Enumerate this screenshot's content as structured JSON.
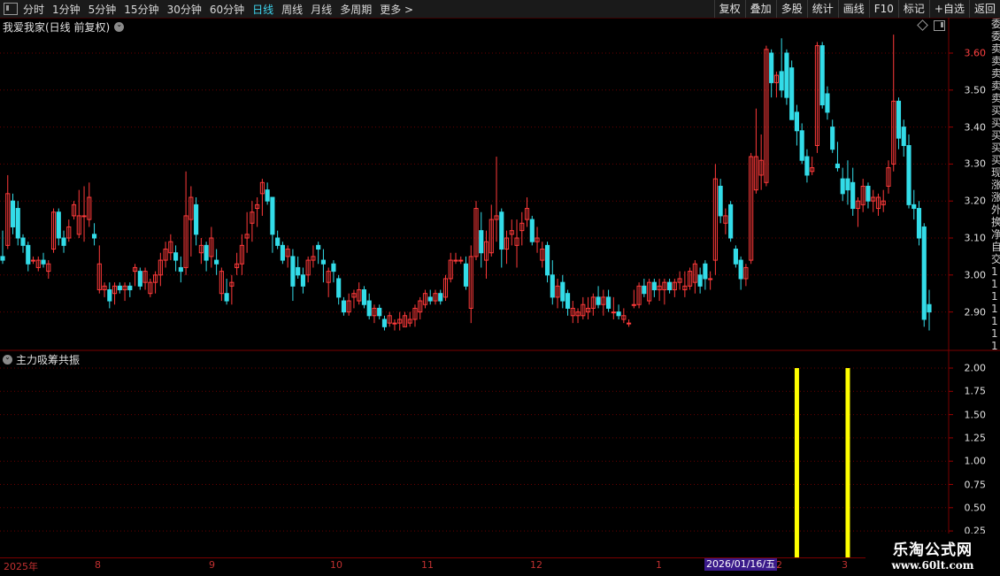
{
  "toolbar": {
    "periods": [
      "分时",
      "1分钟",
      "5分钟",
      "15分钟",
      "30分钟",
      "60分钟",
      "日线",
      "周线",
      "月线",
      "多周期",
      "更多 >"
    ],
    "active_period": "日线",
    "actions": [
      "复权",
      "叠加",
      "多股",
      "统计",
      "画线",
      "F10",
      "标记",
      "+自选",
      "返回"
    ]
  },
  "main_panel": {
    "title": "我爱我家(日线 前复权)",
    "price_ticks": [
      "3.60",
      "3.50",
      "3.40",
      "3.30",
      "3.20",
      "3.10",
      "3.00",
      "2.90"
    ]
  },
  "sub_panel": {
    "title": "主力吸筹共振",
    "ticks": [
      "2.00",
      "1.75",
      "1.50",
      "1.25",
      "1.00",
      "0.75",
      "0.50",
      "0.25"
    ]
  },
  "date_axis": {
    "labels": [
      "2025年",
      "8",
      "9",
      "10",
      "11",
      "12",
      "1",
      "2",
      "3"
    ],
    "cursor_date": "2026/01/16/五"
  },
  "right_strip": [
    "委",
    "委",
    "卖",
    "卖",
    "卖",
    "卖",
    "卖",
    "买",
    "买",
    "买",
    "买",
    "买",
    "现",
    "涨",
    "涨",
    "外",
    "换",
    "净",
    "自",
    "交",
    "1",
    "1",
    "1",
    "1",
    "1",
    "1",
    "1"
  ],
  "watermark": {
    "name": "乐淘公式网",
    "url": "www.60lt.com"
  },
  "colors": {
    "up": "#ff3a3a",
    "down": "#33dce8",
    "signal": "#ffff00",
    "grid": "#6a0000"
  },
  "chart_data": {
    "type": "candlestick",
    "price_range": [
      2.83,
      3.66
    ],
    "indicator_range": [
      0,
      2.2
    ],
    "signals": [
      {
        "index": 156,
        "value": 2.0
      },
      {
        "index": 166,
        "value": 2.0
      }
    ],
    "candles": [
      [
        3.05,
        3.12,
        3.03,
        3.04
      ],
      [
        3.08,
        3.27,
        3.07,
        3.22
      ],
      [
        3.2,
        3.22,
        3.11,
        3.13
      ],
      [
        3.18,
        3.2,
        3.08,
        3.1
      ],
      [
        3.1,
        3.11,
        3.06,
        3.08
      ],
      [
        3.08,
        3.09,
        3.01,
        3.03
      ],
      [
        3.04,
        3.05,
        3.03,
        3.04
      ],
      [
        3.02,
        3.05,
        3.01,
        3.04
      ],
      [
        3.04,
        3.06,
        3.02,
        3.03
      ],
      [
        3.01,
        3.04,
        2.99,
        3.03
      ],
      [
        3.07,
        3.18,
        3.06,
        3.17
      ],
      [
        3.17,
        3.18,
        3.08,
        3.1
      ],
      [
        3.1,
        3.12,
        3.06,
        3.08
      ],
      [
        3.1,
        3.15,
        3.09,
        3.13
      ],
      [
        3.16,
        3.2,
        3.15,
        3.19
      ],
      [
        3.11,
        3.23,
        3.1,
        3.16
      ],
      [
        3.16,
        3.24,
        3.09,
        3.16
      ],
      [
        3.15,
        3.25,
        3.13,
        3.21
      ],
      [
        3.11,
        3.14,
        3.08,
        3.1
      ],
      [
        2.96,
        3.08,
        2.95,
        3.03
      ],
      [
        2.96,
        2.98,
        2.94,
        2.97
      ],
      [
        2.96,
        2.98,
        2.91,
        2.93
      ],
      [
        2.95,
        2.98,
        2.92,
        2.97
      ],
      [
        2.97,
        2.98,
        2.95,
        2.96
      ],
      [
        2.96,
        2.98,
        2.93,
        2.97
      ],
      [
        2.97,
        2.98,
        2.94,
        2.96
      ],
      [
        3.01,
        3.03,
        2.97,
        3.02
      ],
      [
        3.01,
        3.02,
        2.96,
        2.97
      ],
      [
        2.98,
        3.02,
        2.96,
        3.01
      ],
      [
        2.95,
        2.99,
        2.94,
        2.98
      ],
      [
        2.98,
        3.01,
        2.95,
        3.0
      ],
      [
        3.0,
        3.06,
        2.97,
        3.04
      ],
      [
        3.04,
        3.09,
        3.02,
        3.07
      ],
      [
        3.06,
        3.11,
        3.04,
        3.09
      ],
      [
        3.06,
        3.08,
        3.01,
        3.04
      ],
      [
        3.02,
        3.05,
        2.98,
        3.01
      ],
      [
        3.02,
        3.28,
        3.0,
        3.16
      ],
      [
        3.15,
        3.24,
        3.05,
        3.21
      ],
      [
        3.19,
        3.21,
        3.08,
        3.11
      ],
      [
        3.06,
        3.1,
        3.03,
        3.08
      ],
      [
        3.08,
        3.09,
        3.01,
        3.04
      ],
      [
        3.05,
        3.13,
        3.02,
        3.1
      ],
      [
        3.04,
        3.07,
        3.0,
        3.03
      ],
      [
        2.95,
        3.02,
        2.93,
        3.01
      ],
      [
        2.95,
        2.99,
        2.92,
        2.93
      ],
      [
        2.97,
        3.0,
        2.92,
        2.98
      ],
      [
        3.02,
        3.06,
        3.0,
        3.03
      ],
      [
        3.03,
        3.11,
        3.0,
        3.08
      ],
      [
        3.1,
        3.17,
        3.06,
        3.11
      ],
      [
        3.14,
        3.2,
        3.09,
        3.17
      ],
      [
        3.18,
        3.21,
        3.13,
        3.19
      ],
      [
        3.22,
        3.26,
        3.16,
        3.25
      ],
      [
        3.23,
        3.25,
        3.19,
        3.2
      ],
      [
        3.21,
        3.21,
        3.06,
        3.11
      ],
      [
        3.1,
        3.12,
        3.07,
        3.08
      ],
      [
        3.08,
        3.09,
        3.03,
        3.04
      ],
      [
        3.05,
        3.08,
        3.02,
        3.07
      ],
      [
        3.05,
        3.07,
        2.93,
        2.97
      ],
      [
        3.02,
        3.05,
        2.99,
        3.0
      ],
      [
        3.0,
        3.02,
        2.95,
        2.97
      ],
      [
        3.0,
        3.05,
        2.98,
        3.04
      ],
      [
        3.04,
        3.08,
        3.02,
        3.05
      ],
      [
        3.08,
        3.09,
        3.03,
        3.07
      ],
      [
        3.04,
        3.07,
        2.98,
        3.03
      ],
      [
        2.98,
        3.02,
        2.94,
        3.01
      ],
      [
        3.03,
        3.04,
        2.98,
        3.01
      ],
      [
        2.99,
        3.0,
        2.92,
        2.94
      ],
      [
        2.93,
        2.94,
        2.89,
        2.9
      ],
      [
        2.9,
        2.95,
        2.89,
        2.93
      ],
      [
        2.94,
        2.96,
        2.91,
        2.95
      ],
      [
        2.93,
        2.98,
        2.92,
        2.96
      ],
      [
        2.96,
        2.97,
        2.91,
        2.92
      ],
      [
        2.93,
        2.95,
        2.88,
        2.89
      ],
      [
        2.89,
        2.92,
        2.87,
        2.91
      ],
      [
        2.91,
        2.92,
        2.88,
        2.89
      ],
      [
        2.88,
        2.89,
        2.85,
        2.86
      ],
      [
        2.87,
        2.9,
        2.86,
        2.89
      ],
      [
        2.87,
        2.88,
        2.85,
        2.87
      ],
      [
        2.87,
        2.9,
        2.85,
        2.88
      ],
      [
        2.86,
        2.9,
        2.86,
        2.89
      ],
      [
        2.87,
        2.9,
        2.86,
        2.88
      ],
      [
        2.88,
        2.92,
        2.86,
        2.91
      ],
      [
        2.9,
        2.94,
        2.88,
        2.93
      ],
      [
        2.92,
        2.96,
        2.91,
        2.95
      ],
      [
        2.94,
        2.96,
        2.92,
        2.93
      ],
      [
        2.93,
        2.96,
        2.92,
        2.95
      ],
      [
        2.95,
        2.96,
        2.92,
        2.93
      ],
      [
        2.94,
        3.0,
        2.93,
        2.99
      ],
      [
        2.99,
        3.06,
        2.98,
        3.04
      ],
      [
        3.04,
        3.06,
        3.03,
        3.04
      ],
      [
        3.04,
        3.05,
        3.03,
        3.04
      ],
      [
        3.03,
        3.05,
        2.96,
        2.97
      ],
      [
        2.91,
        3.08,
        2.87,
        3.05
      ],
      [
        3.05,
        3.2,
        3.04,
        3.18
      ],
      [
        3.12,
        3.17,
        3.02,
        3.06
      ],
      [
        3.04,
        3.12,
        2.99,
        3.09
      ],
      [
        3.06,
        3.19,
        3.05,
        3.15
      ],
      [
        3.15,
        3.32,
        3.09,
        3.16
      ],
      [
        3.17,
        3.18,
        3.02,
        3.07
      ],
      [
        3.07,
        3.12,
        3.03,
        3.1
      ],
      [
        3.11,
        3.15,
        3.08,
        3.12
      ],
      [
        3.08,
        3.15,
        3.02,
        3.1
      ],
      [
        3.12,
        3.17,
        3.08,
        3.14
      ],
      [
        3.15,
        3.21,
        3.13,
        3.18
      ],
      [
        3.15,
        3.16,
        3.08,
        3.09
      ],
      [
        3.09,
        3.13,
        3.06,
        3.1
      ],
      [
        3.04,
        3.09,
        3.02,
        3.07
      ],
      [
        3.08,
        3.09,
        2.98,
        3.0
      ],
      [
        3.0,
        3.04,
        2.92,
        2.94
      ],
      [
        2.94,
        2.99,
        2.91,
        2.97
      ],
      [
        2.98,
        3.0,
        2.91,
        2.93
      ],
      [
        2.95,
        2.96,
        2.89,
        2.91
      ],
      [
        2.89,
        2.93,
        2.87,
        2.91
      ],
      [
        2.89,
        2.91,
        2.87,
        2.9
      ],
      [
        2.89,
        2.94,
        2.88,
        2.92
      ],
      [
        2.9,
        2.94,
        2.88,
        2.91
      ],
      [
        2.91,
        2.95,
        2.89,
        2.94
      ],
      [
        2.94,
        2.97,
        2.91,
        2.92
      ],
      [
        2.92,
        2.96,
        2.89,
        2.94
      ],
      [
        2.94,
        2.96,
        2.9,
        2.91
      ],
      [
        2.9,
        2.94,
        2.88,
        2.9
      ],
      [
        2.9,
        2.92,
        2.88,
        2.89
      ],
      [
        2.88,
        2.91,
        2.87,
        2.89
      ],
      [
        2.87,
        2.88,
        2.86,
        2.87
      ],
      [
        2.92,
        2.96,
        2.91,
        2.92
      ],
      [
        2.92,
        2.98,
        2.91,
        2.97
      ],
      [
        2.97,
        2.99,
        2.94,
        2.95
      ],
      [
        2.93,
        2.99,
        2.92,
        2.98
      ],
      [
        2.98,
        2.99,
        2.94,
        2.96
      ],
      [
        2.96,
        2.99,
        2.93,
        2.97
      ],
      [
        2.96,
        2.99,
        2.92,
        2.98
      ],
      [
        2.98,
        2.99,
        2.95,
        2.96
      ],
      [
        2.96,
        2.99,
        2.94,
        2.98
      ],
      [
        2.98,
        3.01,
        2.96,
        2.99
      ],
      [
        2.96,
        3.01,
        2.94,
        2.97
      ],
      [
        2.97,
        3.02,
        2.96,
        3.01
      ],
      [
        2.98,
        3.04,
        2.95,
        3.03
      ],
      [
        3.0,
        3.02,
        2.95,
        2.97
      ],
      [
        3.03,
        3.04,
        2.96,
        2.99
      ],
      [
        2.99,
        3.01,
        2.96,
        2.99
      ],
      [
        3.04,
        3.3,
        3.0,
        3.26
      ],
      [
        3.24,
        3.26,
        3.14,
        3.16
      ],
      [
        3.14,
        3.18,
        3.11,
        3.16
      ],
      [
        3.19,
        3.2,
        3.09,
        3.1
      ],
      [
        3.07,
        3.08,
        3.02,
        3.03
      ],
      [
        3.04,
        3.05,
        2.96,
        2.99
      ],
      [
        2.99,
        3.03,
        2.97,
        3.02
      ],
      [
        3.04,
        3.33,
        3.03,
        3.32
      ],
      [
        3.23,
        3.45,
        3.22,
        3.32
      ],
      [
        3.27,
        3.38,
        3.23,
        3.31
      ],
      [
        3.25,
        3.62,
        3.24,
        3.61
      ],
      [
        3.6,
        3.61,
        3.48,
        3.52
      ],
      [
        3.52,
        3.55,
        3.48,
        3.54
      ],
      [
        3.55,
        3.64,
        3.48,
        3.5
      ],
      [
        3.6,
        3.61,
        3.46,
        3.48
      ],
      [
        3.56,
        3.58,
        3.42,
        3.42
      ],
      [
        3.44,
        3.46,
        3.35,
        3.39
      ],
      [
        3.39,
        3.41,
        3.3,
        3.31
      ],
      [
        3.32,
        3.34,
        3.25,
        3.27
      ],
      [
        3.28,
        3.32,
        3.27,
        3.29
      ],
      [
        3.35,
        3.63,
        3.33,
        3.62
      ],
      [
        3.62,
        3.63,
        3.45,
        3.46
      ],
      [
        3.49,
        3.51,
        3.42,
        3.44
      ],
      [
        3.4,
        3.42,
        3.33,
        3.34
      ],
      [
        3.3,
        3.36,
        3.28,
        3.29
      ],
      [
        3.26,
        3.29,
        3.2,
        3.22
      ],
      [
        3.26,
        3.31,
        3.19,
        3.23
      ],
      [
        3.25,
        3.29,
        3.16,
        3.18
      ],
      [
        3.18,
        3.21,
        3.13,
        3.2
      ],
      [
        3.19,
        3.26,
        3.17,
        3.24
      ],
      [
        3.24,
        3.25,
        3.18,
        3.2
      ],
      [
        3.2,
        3.23,
        3.17,
        3.21
      ],
      [
        3.18,
        3.22,
        3.16,
        3.21
      ],
      [
        3.19,
        3.23,
        3.17,
        3.2
      ],
      [
        3.24,
        3.31,
        3.22,
        3.29
      ],
      [
        3.3,
        3.65,
        3.28,
        3.47
      ],
      [
        3.47,
        3.48,
        3.34,
        3.37
      ],
      [
        3.4,
        3.42,
        3.32,
        3.35
      ],
      [
        3.35,
        3.38,
        3.18,
        3.19
      ],
      [
        3.19,
        3.23,
        3.15,
        3.18
      ],
      [
        3.18,
        3.2,
        3.08,
        3.1
      ],
      [
        3.13,
        3.14,
        2.86,
        2.88
      ],
      [
        2.92,
        2.96,
        2.85,
        2.9
      ]
    ]
  }
}
